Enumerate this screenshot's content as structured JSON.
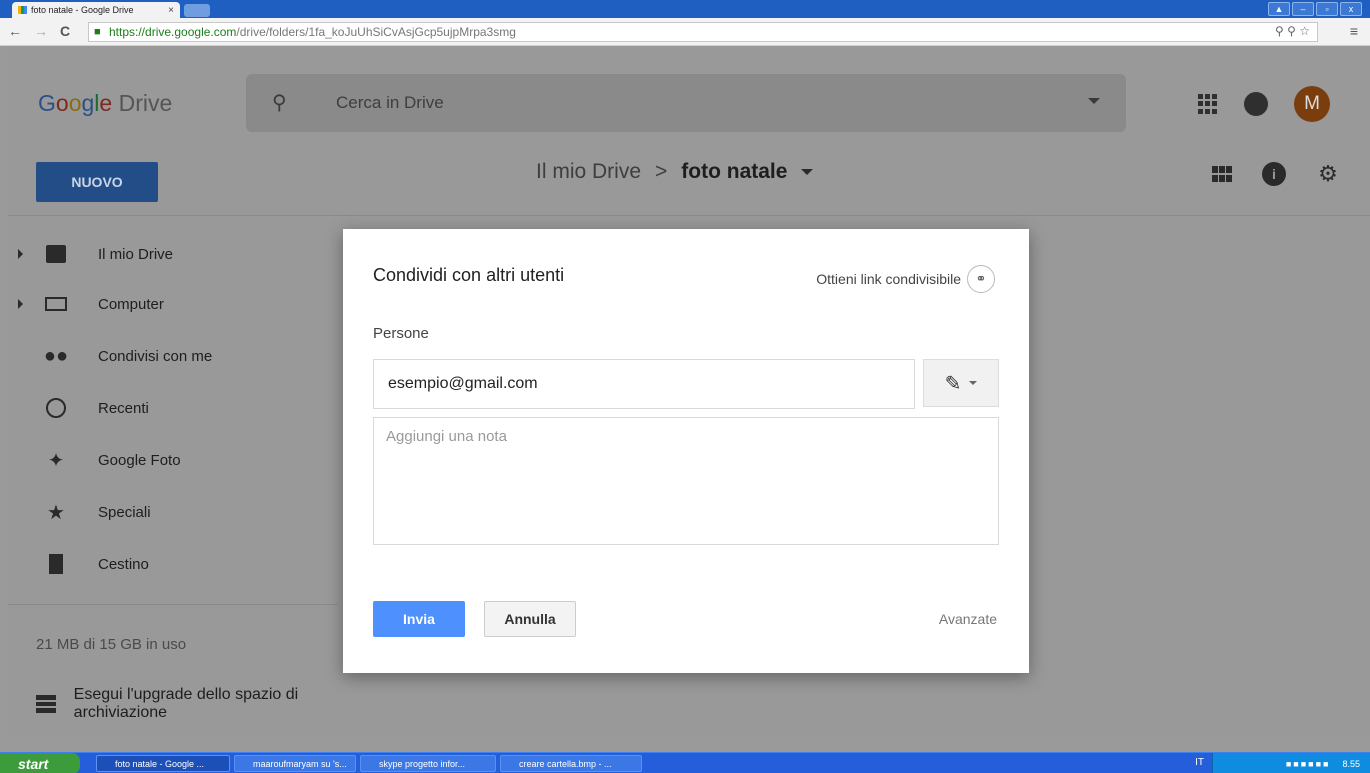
{
  "browser": {
    "tab_title": "foto natale - Google Drive",
    "tab_close": "×",
    "url_scheme": "https://",
    "url_host": "drive.google.com",
    "url_path": "/drive/folders/1fa_koJuUhSiCvAsjGcp5ujpMrpa3smg",
    "nav_back": "←",
    "nav_forward": "→",
    "nav_reload": "C",
    "menu_icon": "≡",
    "win_buttons": [
      "▲",
      "–",
      "▫",
      "x"
    ]
  },
  "drive": {
    "logo_parts": [
      "G",
      "o",
      "o",
      "g",
      "l",
      "e",
      " Drive"
    ],
    "search_placeholder": "Cerca in Drive",
    "avatar_letter": "M",
    "new_button": "NUOVO",
    "breadcrumb_root": "Il mio Drive",
    "breadcrumb_sep": ">",
    "breadcrumb_current": "foto natale",
    "sidebar": [
      {
        "label": "Il mio Drive",
        "icon": "drive-icon"
      },
      {
        "label": "Computer",
        "icon": "computer-icon"
      },
      {
        "label": "Condivisi con me",
        "icon": "people-icon"
      },
      {
        "label": "Recenti",
        "icon": "clock-icon"
      },
      {
        "label": "Google Foto",
        "icon": "pinwheel-icon"
      },
      {
        "label": "Speciali",
        "icon": "star-icon"
      },
      {
        "label": "Cestino",
        "icon": "trash-icon"
      }
    ],
    "storage_text": "21 MB di 15 GB in uso",
    "upgrade_text": "Esegui l'upgrade dello spazio di archiviazione"
  },
  "dialog": {
    "title": "Condividi con altri utenti",
    "share_link_label": "Ottieni link condivisibile",
    "people_label": "Persone",
    "email_value": "esempio@gmail.com",
    "note_placeholder": "Aggiungi una nota",
    "send_label": "Invia",
    "cancel_label": "Annulla",
    "advanced_label": "Avanzate"
  },
  "taskbar": {
    "start_label": "start",
    "tasks": [
      "foto natale - Google ...",
      "maaroufmaryam su 's...",
      "skype progetto infor...",
      "creare cartella.bmp - ..."
    ],
    "lang": "IT",
    "clock": "8.55"
  }
}
